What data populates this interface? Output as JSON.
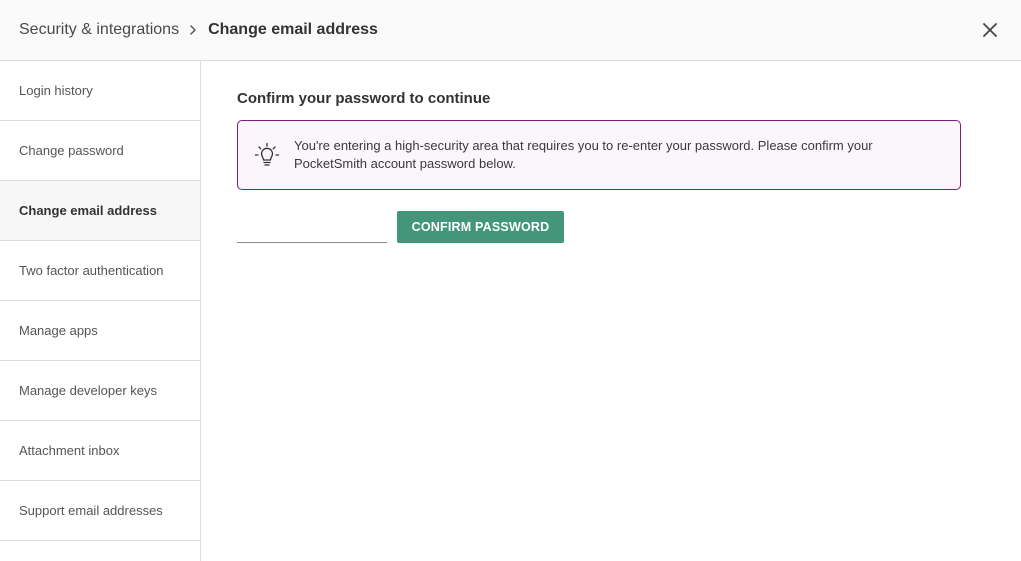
{
  "header": {
    "breadcrumb_parent": "Security & integrations",
    "breadcrumb_current": "Change email address",
    "separator_icon": "chevron-right-icon",
    "close_icon": "close-icon"
  },
  "sidebar": {
    "items": [
      {
        "label": "Login history",
        "active": false
      },
      {
        "label": "Change password",
        "active": false
      },
      {
        "label": "Change email address",
        "active": true
      },
      {
        "label": "Two factor authentication",
        "active": false
      },
      {
        "label": "Manage apps",
        "active": false
      },
      {
        "label": "Manage developer keys",
        "active": false
      },
      {
        "label": "Attachment inbox",
        "active": false
      },
      {
        "label": "Support email addresses",
        "active": false
      }
    ]
  },
  "main": {
    "title": "Confirm your password to continue",
    "notice": {
      "icon": "lightbulb-icon",
      "text": "You're entering a high-security area that requires you to re-enter your password. Please confirm your PocketSmith account password below."
    },
    "password_input": {
      "value": "",
      "placeholder": ""
    },
    "confirm_button_label": "CONFIRM PASSWORD"
  },
  "colors": {
    "accent_button": "#44967a",
    "notice_border": "#7b1f7b",
    "notice_background": "#fbf6fc"
  }
}
